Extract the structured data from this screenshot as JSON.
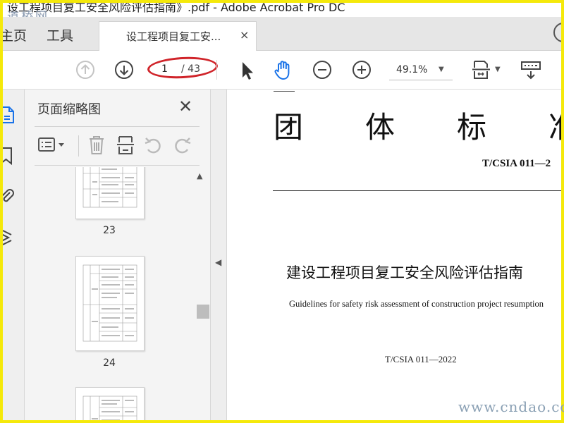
{
  "window": {
    "title": "设工程项目复工安全风险评估指南》.pdf - Adobe Acrobat Pro DC"
  },
  "watermark": {
    "top": "道桥网",
    "bottom": "www.cndao.com"
  },
  "tabs": {
    "home": "主页",
    "tools": "工具",
    "document": "设工程项目复工安...",
    "close": "×"
  },
  "toolbar": {
    "page_current": "1",
    "page_total": "/ 43",
    "zoom": "49.1%"
  },
  "panel": {
    "title": "页面缩略图",
    "close": "✕",
    "thumbnails": [
      {
        "page": "23"
      },
      {
        "page": "24"
      }
    ]
  },
  "document": {
    "header": "团体标准",
    "code_top": "T/CSIA 011—2",
    "title": "建设工程项目复工安全风险评估指南",
    "subtitle": "Guidelines for safety risk assessment of construction project resumption",
    "code_bottom": "T/CSIA 011—2022"
  },
  "colors": {
    "accent": "#1a73e8",
    "highlight_circle": "#d0242a",
    "frame": "#f5e90a"
  }
}
